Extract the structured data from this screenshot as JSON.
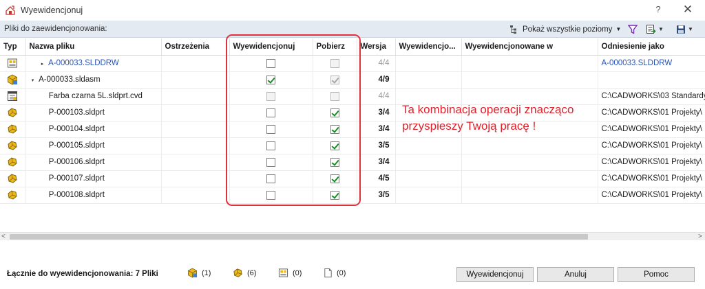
{
  "window": {
    "title": "Wyewidencjonuj",
    "help": "?",
    "close": "✕"
  },
  "toolbar": {
    "label": "Pliki do zaewidencjonowania:",
    "levels_button": "Pokaż wszystkie poziomy"
  },
  "columns": [
    "Typ",
    "Nazwa pliku",
    "Ostrzeżenia",
    "Wyewidencjonuj",
    "Pobierz",
    "Wersja",
    "Wyewidencjo...",
    "Wyewidencjonowane w",
    "Odniesienie jako"
  ],
  "rows": [
    {
      "type_icon": "drawing-icon",
      "name": "A-000033.SLDDRW",
      "caret": "▸",
      "indent": 1,
      "checkin": false,
      "checkin_disabled": false,
      "get": false,
      "get_disabled": true,
      "version": "4/4",
      "version_dim": true,
      "ref": "A-000033.SLDDRW",
      "link": true
    },
    {
      "type_icon": "assembly-icon",
      "name": "A-000033.sldasm",
      "caret": "▾",
      "indent": 0,
      "checkin": true,
      "checkin_disabled": false,
      "get": true,
      "get_disabled": true,
      "version": "4/9",
      "version_dim": false,
      "ref": "",
      "link": false
    },
    {
      "type_icon": "virtual-file-icon",
      "name": "Farba czarna 5L.sldprt.cvd",
      "caret": "",
      "indent": 1,
      "checkin": false,
      "checkin_disabled": true,
      "get": false,
      "get_disabled": true,
      "version": "4/4",
      "version_dim": true,
      "ref": "C:\\CADWORKS\\03 Standardy",
      "link": false
    },
    {
      "type_icon": "part-icon",
      "name": "P-000103.sldprt",
      "caret": "",
      "indent": 1,
      "checkin": false,
      "checkin_disabled": false,
      "get": true,
      "get_disabled": false,
      "version": "3/4",
      "version_dim": false,
      "ref": "C:\\CADWORKS\\01 Projekty\\",
      "link": false
    },
    {
      "type_icon": "part-icon",
      "name": "P-000104.sldprt",
      "caret": "",
      "indent": 1,
      "checkin": false,
      "checkin_disabled": false,
      "get": true,
      "get_disabled": false,
      "version": "3/4",
      "version_dim": false,
      "ref": "C:\\CADWORKS\\01 Projekty\\",
      "link": false
    },
    {
      "type_icon": "part-icon",
      "name": "P-000105.sldprt",
      "caret": "",
      "indent": 1,
      "checkin": false,
      "checkin_disabled": false,
      "get": true,
      "get_disabled": false,
      "version": "3/5",
      "version_dim": false,
      "ref": "C:\\CADWORKS\\01 Projekty\\",
      "link": false
    },
    {
      "type_icon": "part-icon",
      "name": "P-000106.sldprt",
      "caret": "",
      "indent": 1,
      "checkin": false,
      "checkin_disabled": false,
      "get": true,
      "get_disabled": false,
      "version": "3/4",
      "version_dim": false,
      "ref": "C:\\CADWORKS\\01 Projekty\\",
      "link": false
    },
    {
      "type_icon": "part-icon",
      "name": "P-000107.sldprt",
      "caret": "",
      "indent": 1,
      "checkin": false,
      "checkin_disabled": false,
      "get": true,
      "get_disabled": false,
      "version": "4/5",
      "version_dim": false,
      "ref": "C:\\CADWORKS\\01 Projekty\\",
      "link": false
    },
    {
      "type_icon": "part-icon",
      "name": "P-000108.sldprt",
      "caret": "",
      "indent": 1,
      "checkin": false,
      "checkin_disabled": false,
      "get": true,
      "get_disabled": false,
      "version": "3/5",
      "version_dim": false,
      "ref": "C:\\CADWORKS\\01 Projekty\\",
      "link": false
    }
  ],
  "annotation": {
    "line1": "Ta kombinacja operacji znacząco",
    "line2": "przyspieszy Twoją pracę !",
    "color": "#e0202a"
  },
  "footer": {
    "total_label": "Łącznie do wyewidencjonowania:  7 Pliki",
    "counts": {
      "assemblies": "(1)",
      "parts": "(6)",
      "drawings": "(0)",
      "other": "(0)"
    },
    "checkin_button": "Wyewidencjonuj",
    "cancel_button": "Anuluj",
    "help_button": "Pomoc"
  }
}
